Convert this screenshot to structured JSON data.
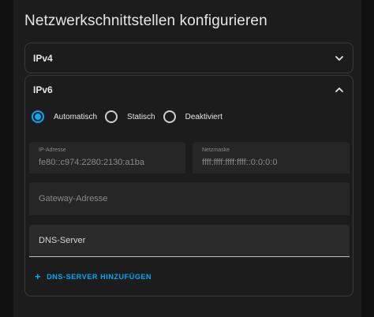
{
  "dialog": {
    "title": "Netzwerkschnittstellen konfigurieren"
  },
  "ipv4": {
    "label": "IPv4",
    "expanded": false,
    "chevron_icon": "chevron-down-icon"
  },
  "ipv6": {
    "label": "IPv6",
    "expanded": true,
    "chevron_icon": "chevron-up-icon",
    "modes": [
      {
        "label": "Automatisch",
        "checked": true
      },
      {
        "label": "Statisch",
        "checked": false
      },
      {
        "label": "Deaktiviert",
        "checked": false
      }
    ],
    "ip_address": {
      "label": "IP-Adresse",
      "value": "fe80::c974:2280:2130:a1ba"
    },
    "netmask": {
      "label": "Netzmaske",
      "value": "ffff:ffff:ffff:ffff::0:0:0:0"
    },
    "gateway": {
      "placeholder": "Gateway-Adresse"
    },
    "dns": {
      "placeholder": "DNS-Server"
    },
    "add_dns_label": "DNS-SERVER HINZUFÜGEN"
  },
  "colors": {
    "accent": "#03a9f4",
    "background": "#1c1c1c",
    "field": "#262626"
  }
}
